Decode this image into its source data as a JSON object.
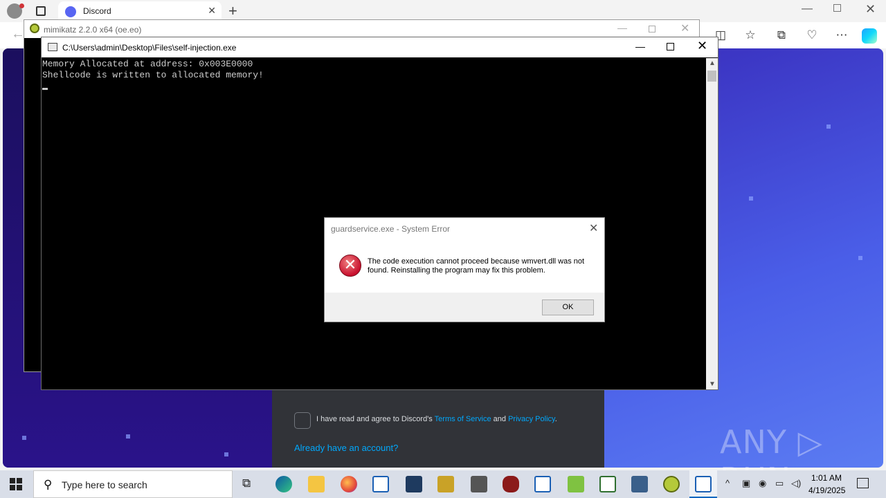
{
  "browser": {
    "tab_title": "Discord",
    "tab_close": "✕",
    "new_tab": "+",
    "window_minimize": "—",
    "window_close": "✕",
    "back": "←"
  },
  "discord_page": {
    "tos_prefix": "I have read and agree to Discord's ",
    "tos_link": "Terms of Service",
    "tos_and": " and ",
    "privacy_link": "Privacy Policy",
    "tos_suffix": ".",
    "login_link": "Already have an account?",
    "watermark": "ANY ▷ RUN"
  },
  "mimikatz_window": {
    "title": "mimikatz 2.2.0 x64 (oe.eo)"
  },
  "console_window": {
    "title": "C:\\Users\\admin\\Desktop\\Files\\self-injection.exe",
    "lines": [
      "Memory Allocated at address: 0x003E0000",
      "Shellcode is written to allocated memory!"
    ]
  },
  "error_dialog": {
    "title": "guardservice.exe - System Error",
    "message": "The code execution cannot proceed because wmvert.dll was not found. Reinstalling the program may fix this problem.",
    "ok_label": "OK",
    "close": "✕",
    "icon_glyph": "✕"
  },
  "taskbar": {
    "search_placeholder": "Type here to search",
    "time": "1:01 AM",
    "date": "4/19/2025"
  }
}
